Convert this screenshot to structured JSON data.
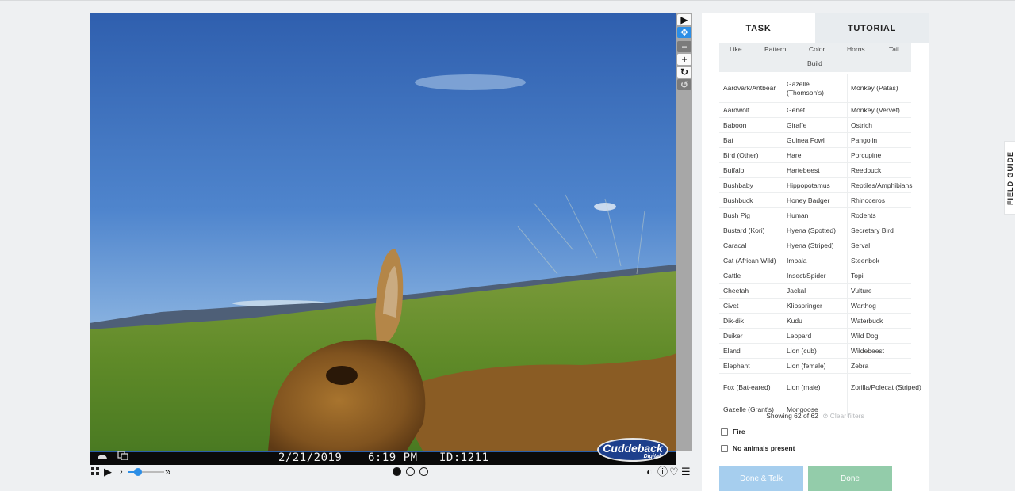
{
  "image": {
    "date": "2/21/2019",
    "time": "6:19 PM",
    "camera_id": "ID:1211",
    "brand_name": "Cuddeback",
    "brand_sub": "Digital"
  },
  "toolbar": {
    "tools": [
      "pointer",
      "move",
      "zoom-out",
      "zoom-in",
      "rotate",
      "reset"
    ],
    "active_tool": "move"
  },
  "controls": {
    "frames_total": 3,
    "current_frame": 1,
    "playback_speed_fraction": 0.25
  },
  "tabs": [
    "TASK",
    "TUTORIAL"
  ],
  "active_tab": "TASK",
  "filters": [
    "Like",
    "Pattern",
    "Color",
    "Horns",
    "Tail",
    "Build"
  ],
  "species": [
    [
      "Aardvark/Antbear",
      "Gazelle (Thomson's)",
      "Monkey (Patas)"
    ],
    [
      "Aardwolf",
      "Genet",
      "Monkey (Vervet)"
    ],
    [
      "Baboon",
      "Giraffe",
      "Ostrich"
    ],
    [
      "Bat",
      "Guinea Fowl",
      "Pangolin"
    ],
    [
      "Bird (Other)",
      "Hare",
      "Porcupine"
    ],
    [
      "Buffalo",
      "Hartebeest",
      "Reedbuck"
    ],
    [
      "Bushbaby",
      "Hippopotamus",
      "Reptiles/Amphibians"
    ],
    [
      "Bushbuck",
      "Honey Badger",
      "Rhinoceros"
    ],
    [
      "Bush Pig",
      "Human",
      "Rodents"
    ],
    [
      "Bustard (Kori)",
      "Hyena (Spotted)",
      "Secretary Bird"
    ],
    [
      "Caracal",
      "Hyena (Striped)",
      "Serval"
    ],
    [
      "Cat (African Wild)",
      "Impala",
      "Steenbok"
    ],
    [
      "Cattle",
      "Insect/Spider",
      "Topi"
    ],
    [
      "Cheetah",
      "Jackal",
      "Vulture"
    ],
    [
      "Civet",
      "Klipspringer",
      "Warthog"
    ],
    [
      "Dik-dik",
      "Kudu",
      "Waterbuck"
    ],
    [
      "Duiker",
      "Leopard",
      "Wild Dog"
    ],
    [
      "Eland",
      "Lion (cub)",
      "Wildebeest"
    ],
    [
      "Elephant",
      "Lion (female)",
      "Zebra"
    ],
    [
      "Fox (Bat-eared)",
      "Lion (male)",
      "Zorilla/Polecat (Striped)"
    ],
    [
      "Gazelle (Grant's)",
      "Mongoose",
      ""
    ]
  ],
  "showing_text": "Showing 62 of 62",
  "clear_filters": "Clear filters",
  "checks": [
    "Fire",
    "No animals present"
  ],
  "buttons": {
    "done_talk": "Done & Talk",
    "done": "Done"
  },
  "field_guide": "FIELD GUIDE",
  "colors": {
    "accent": "#2c8ee6",
    "done_talk": "#a6ceee",
    "done": "#93ccaa"
  }
}
